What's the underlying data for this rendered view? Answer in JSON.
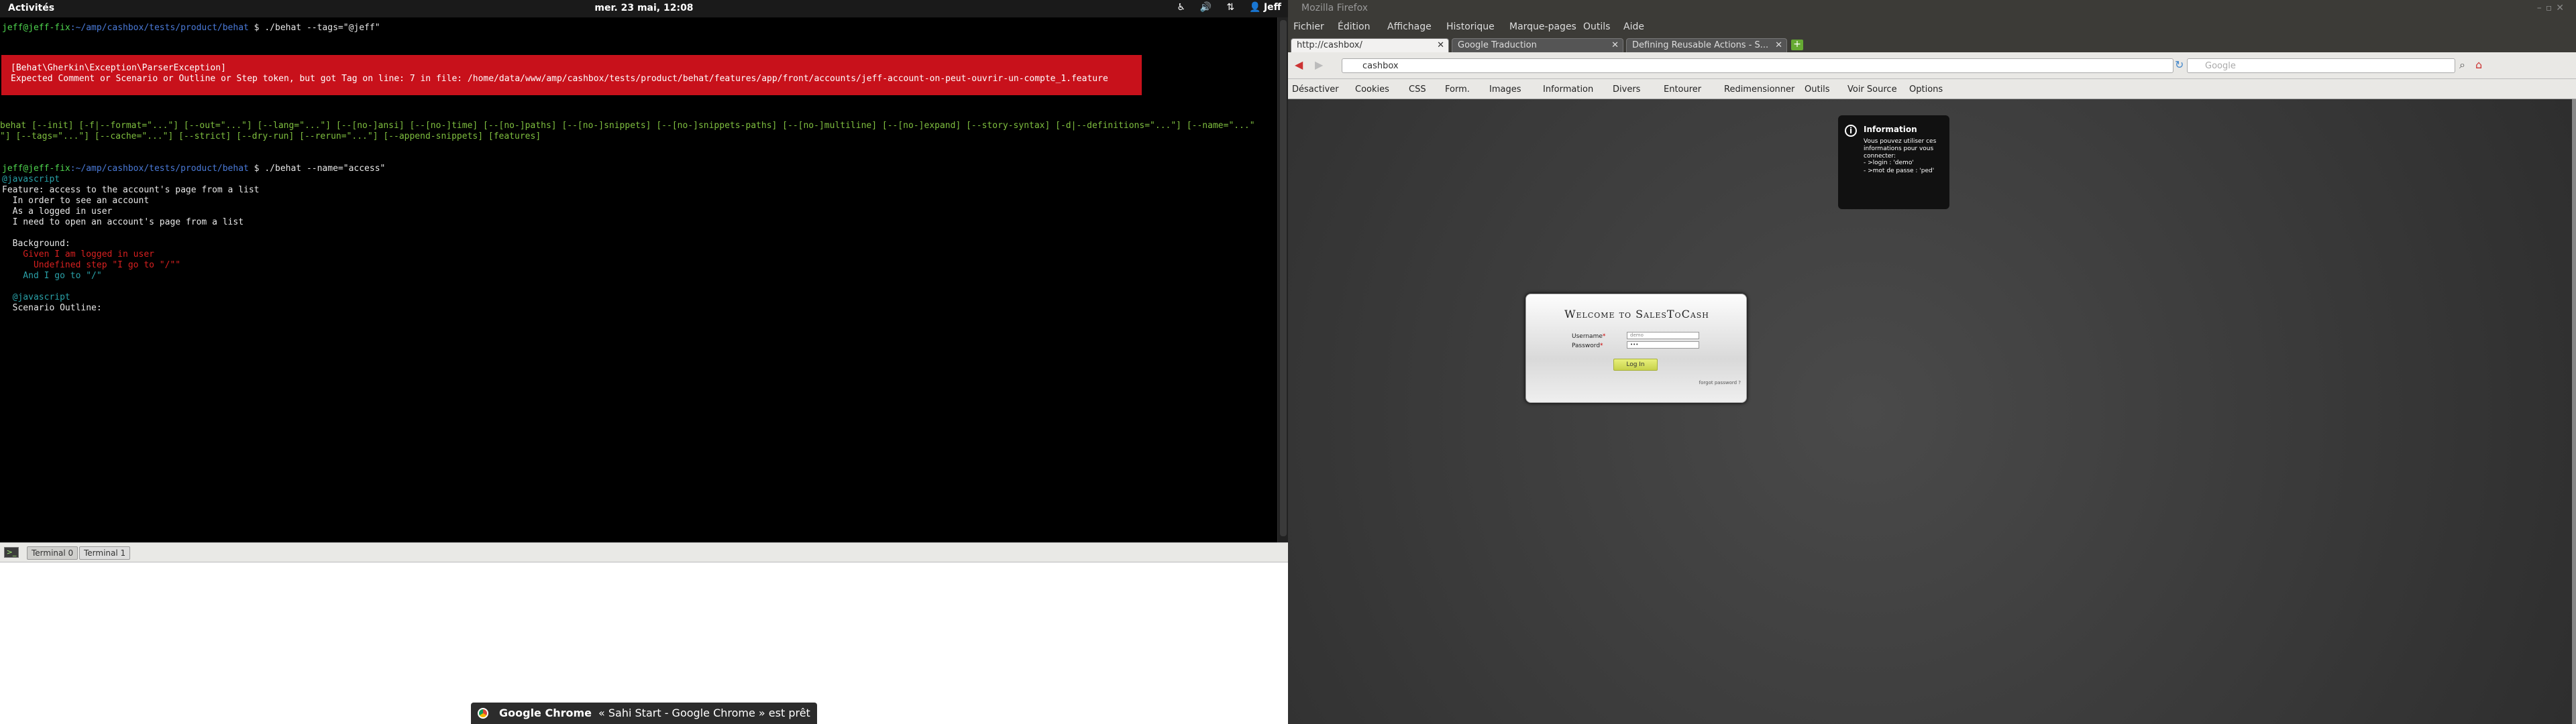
{
  "topbar": {
    "activities": "Activités",
    "clock": "mer. 23 mai, 12:08",
    "user": "Jeff"
  },
  "terminal": {
    "prompt1_user": "jeff@jeff-fix",
    "prompt1_path": ":~/amp/cashbox/tests/product/behat",
    "prompt1_cmd": " $ ./behat --tags=\"@jeff\"",
    "error_title": "[Behat\\Gherkin\\Exception\\ParserException]",
    "error_msg": "Expected Comment or Scenario or Outline or Step token, but got Tag on line: 7 in file: /home/data/www/amp/cashbox/tests/product/behat/features/app/front/accounts/jeff-account-on-peut-ouvrir-un-compte_1.feature",
    "usage1": "behat [--init] [-f|--format=\"...\"] [--out=\"...\"] [--lang=\"...\"] [--[no-]ansi] [--[no-]time] [--[no-]paths] [--[no-]snippets] [--[no-]snippets-paths] [--[no-]multiline] [--[no-]expand] [--story-syntax] [-d|--definitions=\"...\"] [--name=\"...\"",
    "usage2": "\"] [--tags=\"...\"] [--cache=\"...\"] [--strict] [--dry-run] [--rerun=\"...\"] [--append-snippets] [features]",
    "prompt2_user": "jeff@jeff-fix",
    "prompt2_path": ":~/amp/cashbox/tests/product/behat",
    "prompt2_cmd": " $ ./behat --name=\"access\"",
    "tag1": "@javascript",
    "feature": "Feature: access to the account's page from a list",
    "l1": "  In order to see an account",
    "l2": "  As a logged in user",
    "l3": "  I need to open an account's page from a list",
    "background": "  Background:",
    "given": "    Given I am logged in user",
    "undefined": "      Undefined step \"I go to \"/\"\"",
    "and": "    And I go to \"/\"",
    "tag2": "  @javascript",
    "outline": "  Scenario Outline:"
  },
  "term_tabs": [
    "Terminal 0",
    "Terminal 1"
  ],
  "notification": {
    "app": "Google Chrome",
    "text": "« Sahi Start - Google Chrome » est prêt"
  },
  "firefox": {
    "window_title": "Mozilla Firefox",
    "menu": [
      "Fichier",
      "Édition",
      "Affichage",
      "Historique",
      "Marque-pages",
      "Outils",
      "Aide"
    ],
    "tabs": [
      "http://cashbox/",
      "Google Traduction",
      "Defining Reusable Actions - S..."
    ],
    "url": "cashbox",
    "search_placeholder": "Google",
    "webdev": [
      "Désactiver",
      "Cookies",
      "CSS",
      "Form.",
      "Images",
      "Information",
      "Divers",
      "Entourer",
      "Redimensionner",
      "Outils",
      "Voir Source",
      "Options"
    ]
  },
  "info_popup": {
    "title": "Information",
    "text1": "Vous pouvez utiliser ces informations pour vous connecter:",
    "text2": "- >login : 'demo'",
    "text3": "- >mot de passe : 'ped'"
  },
  "login": {
    "title": "Welcome to SalesToCash",
    "username_label": "Username",
    "username_value": "demo",
    "password_label": "Password",
    "password_value": "•••",
    "button": "Log In",
    "forgot": "forgot password ?"
  }
}
